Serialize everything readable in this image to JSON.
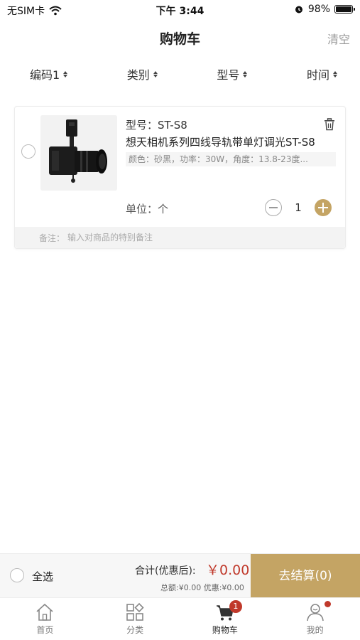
{
  "status_bar": {
    "carrier": "无SIM卡",
    "time": "下午 3:44",
    "battery": "98%",
    "battery_level": 0.98
  },
  "nav": {
    "title": "购物车",
    "clear": "清空"
  },
  "sort": [
    {
      "label": "编码1"
    },
    {
      "label": "类别"
    },
    {
      "label": "型号"
    },
    {
      "label": "时间"
    }
  ],
  "item": {
    "model": "型号：ST-S8",
    "title": "想天相机系列四线导轨带单灯调光ST-S8",
    "spec": "颜色：砂黑，功率：30W，角度：13.8-23度...",
    "unit": "单位：个",
    "qty": "1",
    "remark_label": "备注：",
    "remark_placeholder": "输入对商品的特别备注"
  },
  "checkout": {
    "select_all": "全选",
    "total_label": "合计(优惠后):",
    "total_value": "￥0.00",
    "sub_totals": "总额:¥0.00 优惠:¥0.00",
    "button": "去结算(0)"
  },
  "tabs": [
    {
      "label": "首页",
      "icon": "home-icon"
    },
    {
      "label": "分类",
      "icon": "category-icon"
    },
    {
      "label": "购物车",
      "icon": "cart-icon",
      "badge": "1"
    },
    {
      "label": "我的",
      "icon": "user-icon"
    }
  ],
  "colors": {
    "accent": "#c4a464",
    "price": "#c0392b"
  }
}
